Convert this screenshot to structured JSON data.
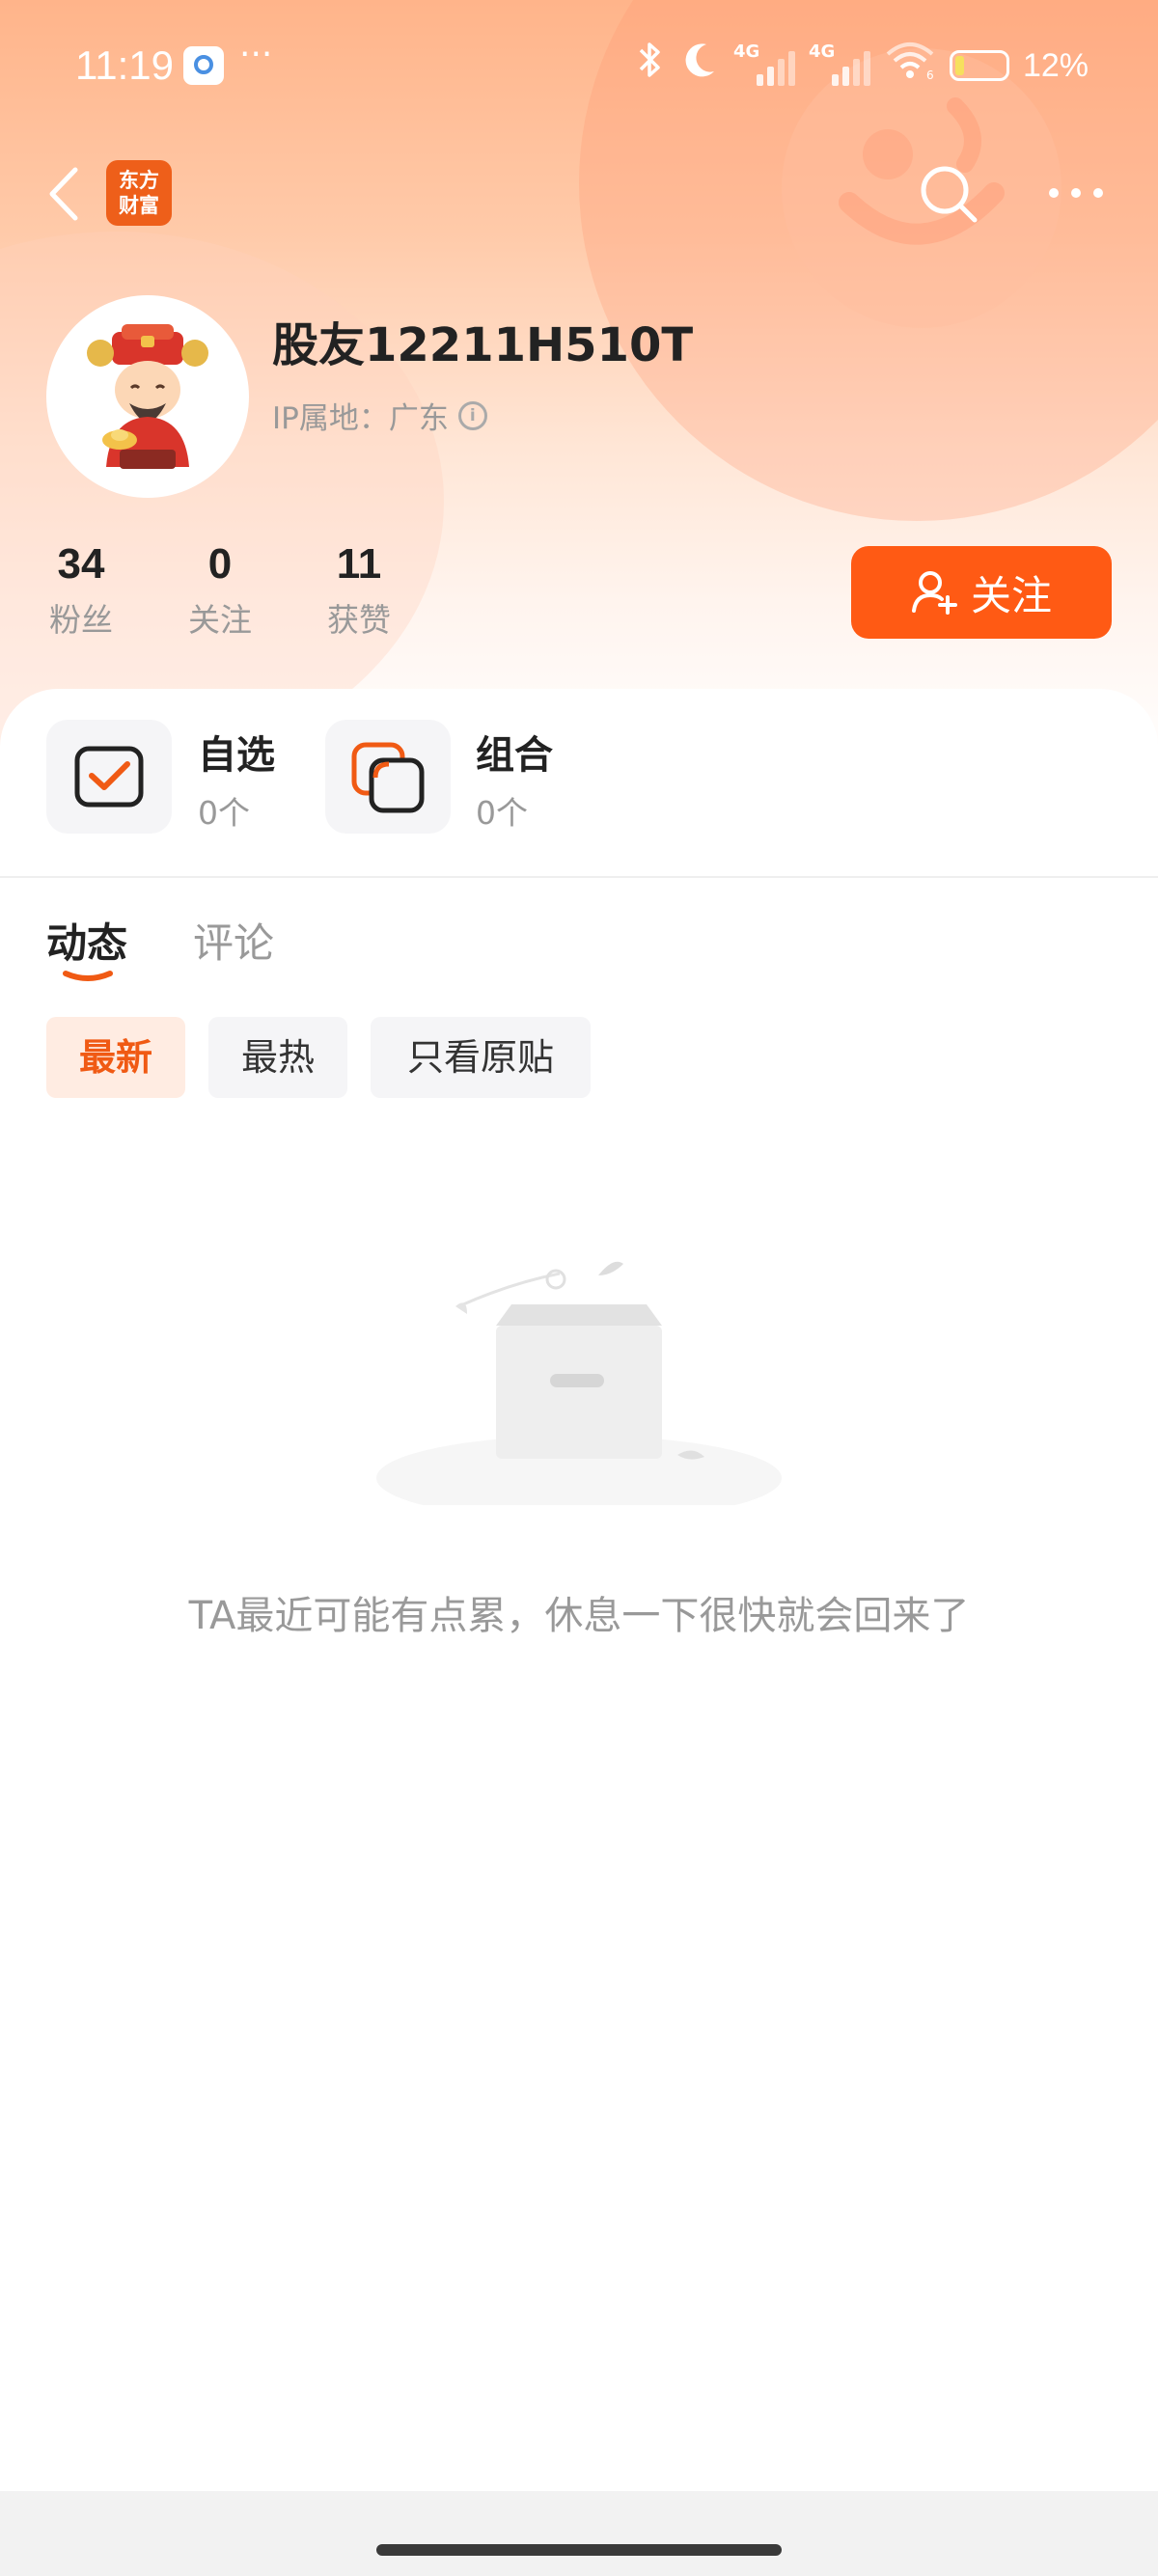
{
  "status_bar": {
    "time": "11:19",
    "dots": "···",
    "net1": "4G",
    "net2": "4G",
    "wifi_label": "6",
    "battery": "12%"
  },
  "header": {
    "brand_line1": "东方",
    "brand_line2": "财富"
  },
  "profile": {
    "username": "股友12211H510T",
    "ip_location": "IP属地：广东"
  },
  "stats": [
    {
      "value": "34",
      "label": "粉丝"
    },
    {
      "value": "0",
      "label": "关注"
    },
    {
      "value": "11",
      "label": "获赞"
    }
  ],
  "follow_button": {
    "label": "关注"
  },
  "assets": [
    {
      "title": "自选",
      "count": "0个"
    },
    {
      "title": "组合",
      "count": "0个"
    }
  ],
  "tabs": [
    {
      "label": "动态",
      "active": true
    },
    {
      "label": "评论",
      "active": false
    }
  ],
  "filters": [
    {
      "label": "最新",
      "active": true
    },
    {
      "label": "最热",
      "active": false
    },
    {
      "label": "只看原贴",
      "active": false
    }
  ],
  "empty_state": {
    "message": "TA最近可能有点累，休息一下很快就会回来了"
  },
  "colors": {
    "accent": "#ff5a14",
    "active_text": "#f05a14",
    "muted_text": "#999999"
  }
}
